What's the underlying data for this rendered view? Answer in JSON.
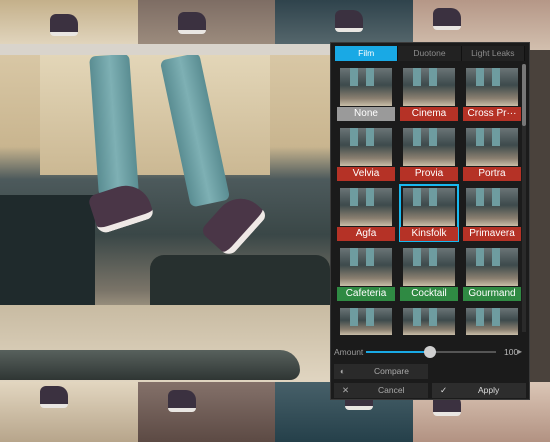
{
  "tabs": [
    {
      "label": "Film",
      "active": true
    },
    {
      "label": "Duotone",
      "active": false
    },
    {
      "label": "Light Leaks",
      "active": false
    }
  ],
  "filters": [
    {
      "label": "None",
      "color": "#9a9a9a"
    },
    {
      "label": "Cinema",
      "color": "#b53226"
    },
    {
      "label": "Cross Pr···",
      "color": "#b53226"
    },
    {
      "label": "Velvia",
      "color": "#b53226"
    },
    {
      "label": "Provia",
      "color": "#b53226"
    },
    {
      "label": "Portra",
      "color": "#b53226"
    },
    {
      "label": "Agfa",
      "color": "#b53226"
    },
    {
      "label": "Kinsfolk",
      "color": "#b53226",
      "selected": true
    },
    {
      "label": "Primavera",
      "color": "#b53226"
    },
    {
      "label": "Cafeteria",
      "color": "#2f8a43"
    },
    {
      "label": "Cocktail",
      "color": "#2f8a43"
    },
    {
      "label": "Gourmand",
      "color": "#2f8a43"
    },
    {
      "label": "",
      "color": "#3a3a3a"
    },
    {
      "label": "",
      "color": "#3a3a3a"
    },
    {
      "label": "",
      "color": "#3a3a3a"
    }
  ],
  "amount": {
    "label": "Amount",
    "value": "100",
    "arrow": "▸",
    "level": 0.55
  },
  "compare": {
    "label": "Compare",
    "icon": "compare-icon"
  },
  "cancel": {
    "label": "Cancel",
    "icon": "close-icon"
  },
  "apply": {
    "label": "Apply",
    "icon": "check-icon"
  },
  "colors": {
    "accent": "#19a9e5",
    "red_label": "#b53226",
    "green_label": "#2f8a43"
  }
}
